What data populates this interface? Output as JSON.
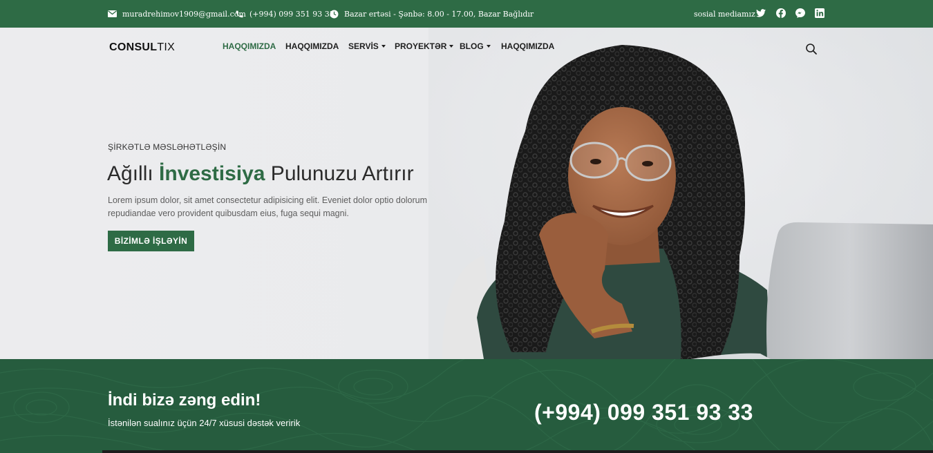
{
  "topbar": {
    "email": "muradrehimov1909@gmail.com",
    "phone": "(+994) 099 351 93 33",
    "hours": "Bazar ertəsi - Şənbə: 8.00 - 17.00, Bazar Bağlıdır",
    "social_label": "sosial mediamız",
    "social_icons": [
      "twitter-icon",
      "facebook-icon",
      "messenger-icon",
      "linkedin-icon"
    ],
    "background": "#2e6b45"
  },
  "logo": {
    "bold": "CONSUL",
    "light": "TIX"
  },
  "nav": {
    "items": [
      {
        "label": "HAQQIMIZDA",
        "active": true,
        "dropdown": false
      },
      {
        "label": "HAQQIMIZDA",
        "active": false,
        "dropdown": false
      },
      {
        "label": "SERVİS",
        "active": false,
        "dropdown": true
      },
      {
        "label": "PROYEKTƏR",
        "active": false,
        "dropdown": true
      },
      {
        "label": "BLOG",
        "active": false,
        "dropdown": true
      },
      {
        "label": "HAQQIMIZDA",
        "active": false,
        "dropdown": false
      }
    ],
    "search_icon": "search-icon"
  },
  "hero": {
    "eyebrow": "ŞİRKƏTLƏ MƏSLƏHƏTLƏŞİN",
    "headline_pre": "Ağıllı ",
    "headline_highlight": "İnvestisiya",
    "headline_post": " Pulunuzu Artırır",
    "lead": "Lorem ipsum dolor, sit amet consectetur adipisicing elit. Eveniet dolor optio dolorum repudiandae vero provident quibusdam eius, fuga sequi magni.",
    "cta_label": "BİZİMLƏ İŞLƏYİN",
    "accent": "#2e6b45"
  },
  "callband": {
    "title": "İndi bizə zəng edin!",
    "subtitle": "İstənilən sualınız üçün 24/7 xüsusi dəstək veririk",
    "phone": "(+994) 099 351 93 33",
    "background": "#265c3e"
  }
}
